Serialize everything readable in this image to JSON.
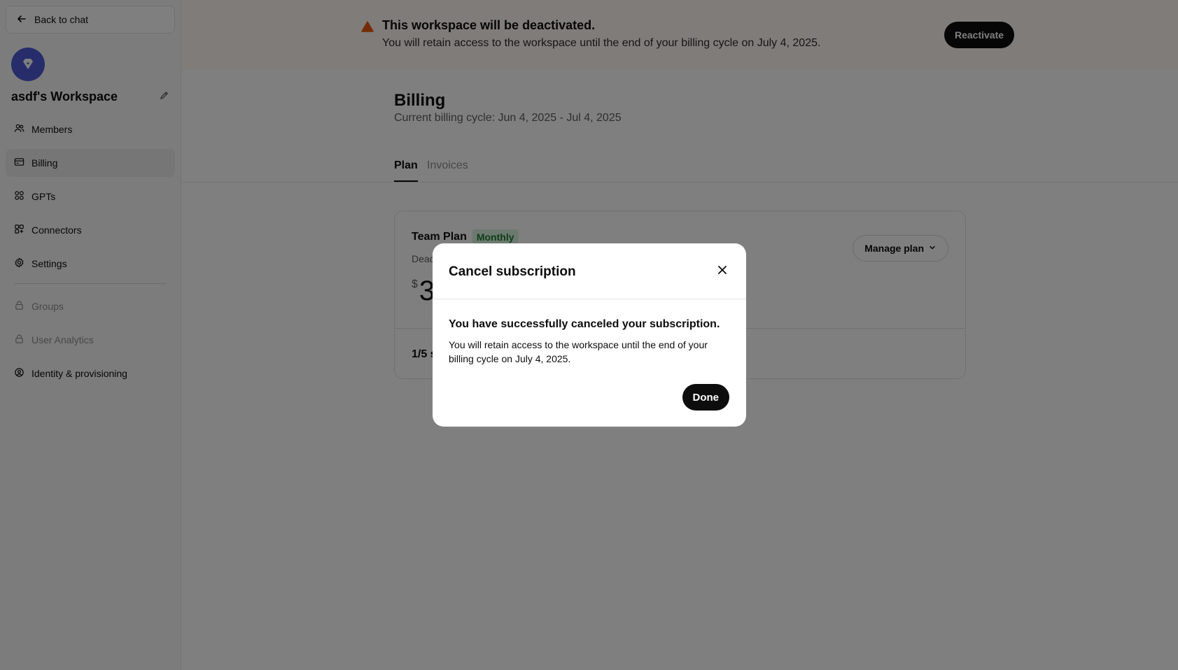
{
  "sidebar": {
    "back_label": "Back to chat",
    "workspace_name": "asdf's Workspace",
    "items": [
      {
        "label": "Members",
        "icon": "members-icon",
        "state": "normal"
      },
      {
        "label": "Billing",
        "icon": "card-icon",
        "state": "active"
      },
      {
        "label": "GPTs",
        "icon": "grid-icon",
        "state": "normal"
      },
      {
        "label": "Connectors",
        "icon": "connectors-icon",
        "state": "normal"
      },
      {
        "label": "Settings",
        "icon": "gear-icon",
        "state": "normal"
      }
    ],
    "locked_items": [
      {
        "label": "Groups",
        "icon": "lock-icon"
      },
      {
        "label": "User Analytics",
        "icon": "lock-icon"
      },
      {
        "label": "Identity & provisioning",
        "icon": "shield-icon"
      }
    ]
  },
  "banner": {
    "title": "This workspace will be deactivated.",
    "subtitle": "You will retain access to the workspace until the end of your billing cycle on July 4, 2025.",
    "reactivate_label": "Reactivate",
    "warning_color": "#e8590c"
  },
  "billing": {
    "title": "Billing",
    "cycle": "Current billing cycle: Jun 4, 2025 - Jul 4, 2025",
    "tabs": [
      {
        "label": "Plan",
        "active": true
      },
      {
        "label": "Invoices",
        "active": false
      }
    ]
  },
  "plan_card": {
    "name": "Team Plan",
    "badge": "Monthly",
    "status_partial": "Deac",
    "price_currency": "$",
    "price_partial": "3",
    "seats_partial": "1/5 s",
    "manage_label": "Manage plan"
  },
  "modal": {
    "title": "Cancel subscription",
    "message": "You have successfully canceled your subscription.",
    "description": "You will retain access to the workspace until the end of your billing cycle on July 4, 2025.",
    "done_label": "Done"
  },
  "colors": {
    "accent": "#4c5bd4",
    "primary_button": "#0d0d0d",
    "badge_bg": "#d9f2dd",
    "badge_text": "#1e7a34"
  }
}
